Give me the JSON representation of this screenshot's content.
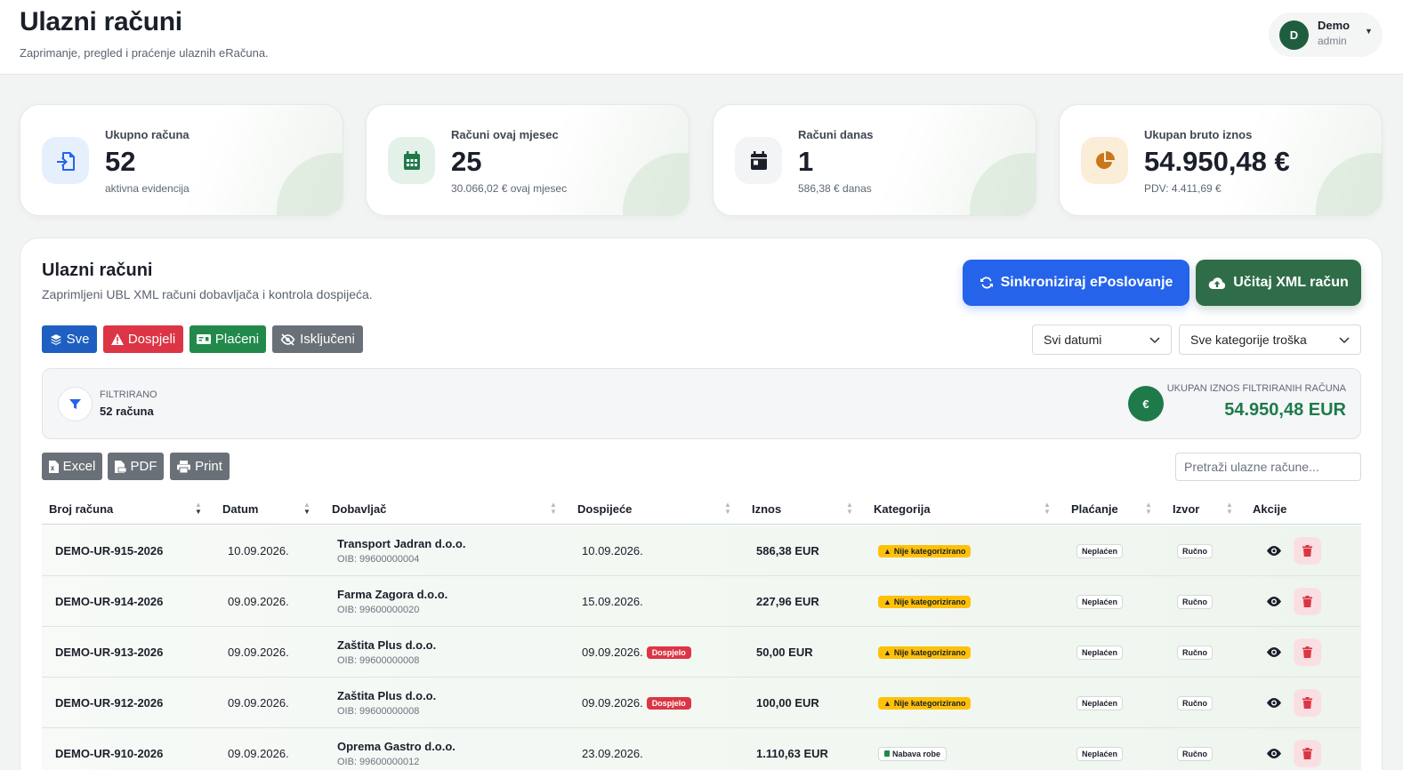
{
  "header": {
    "title": "Ulazni računi",
    "subtitle": "Zaprimanje, pregled i praćenje ulaznih eRačuna."
  },
  "user": {
    "initial": "D",
    "name": "Demo",
    "role": "admin"
  },
  "stats": [
    {
      "label": "Ukupno računa",
      "value": "52",
      "sub": "aktivna evidencija",
      "icon": "file-import-icon",
      "color": "#2563eb"
    },
    {
      "label": "Računi ovaj mjesec",
      "value": "25",
      "sub": "30.066,02 € ovaj mjesec",
      "icon": "calendar-days-icon",
      "color": "#1f7a4a"
    },
    {
      "label": "Računi danas",
      "value": "1",
      "sub": "586,38 € danas",
      "icon": "calendar-day-icon",
      "color": "#1b1f2a"
    },
    {
      "label": "Ukupan bruto iznos",
      "value": "54.950,48 €",
      "sub": "PDV: 4.411,69 €",
      "icon": "pie-chart-icon",
      "color": "#c9771c"
    }
  ],
  "panel": {
    "title": "Ulazni računi",
    "subtitle": "Zaprimljeni UBL XML računi dobavljača i kontrola dospijeća.",
    "sync_label": "Sinkroniziraj ePoslovanje",
    "upload_label": "Učitaj XML račun"
  },
  "filters": {
    "all": "Sve",
    "due": "Dospjeli",
    "paid": "Plaćeni",
    "excluded": "Isključeni"
  },
  "selects": {
    "date": "Svi datumi",
    "category": "Sve kategorije troška"
  },
  "summary": {
    "filtered_label": "FILTRIRANO",
    "filtered_count": "52 računa",
    "currency_symbol": "€",
    "total_label": "UKUPAN IZNOS FILTRIRANIH RAČUNA",
    "total_value": "54.950,48 EUR"
  },
  "exports": {
    "excel": "Excel",
    "pdf": "PDF",
    "print": "Print"
  },
  "search": {
    "placeholder": "Pretraži ulazne račune..."
  },
  "table": {
    "columns": [
      "Broj računa",
      "Datum",
      "Dobavljač",
      "Dospijeće",
      "Iznos",
      "Kategorija",
      "Plaćanje",
      "Izvor",
      "Akcije"
    ],
    "rows": [
      {
        "number": "DEMO-UR-915-2026",
        "date": "10.09.2026.",
        "supplier": "Transport Jadran d.o.o.",
        "oib": "OIB: 99600000004",
        "due": "10.09.2026.",
        "due_badge": "",
        "amount": "586,38 EUR",
        "category": "Nije kategorizirano",
        "category_type": "warn",
        "payment": "Neplaćen",
        "source": "Ručno"
      },
      {
        "number": "DEMO-UR-914-2026",
        "date": "09.09.2026.",
        "supplier": "Farma Zagora d.o.o.",
        "oib": "OIB: 99600000020",
        "due": "15.09.2026.",
        "due_badge": "",
        "amount": "227,96 EUR",
        "category": "Nije kategorizirano",
        "category_type": "warn",
        "payment": "Neplaćen",
        "source": "Ručno"
      },
      {
        "number": "DEMO-UR-913-2026",
        "date": "09.09.2026.",
        "supplier": "Zaštita Plus d.o.o.",
        "oib": "OIB: 99600000008",
        "due": "09.09.2026.",
        "due_badge": "Dospjelo",
        "amount": "50,00 EUR",
        "category": "Nije kategorizirano",
        "category_type": "warn",
        "payment": "Neplaćen",
        "source": "Ručno"
      },
      {
        "number": "DEMO-UR-912-2026",
        "date": "09.09.2026.",
        "supplier": "Zaštita Plus d.o.o.",
        "oib": "OIB: 99600000008",
        "due": "09.09.2026.",
        "due_badge": "Dospjelo",
        "amount": "100,00 EUR",
        "category": "Nije kategorizirano",
        "category_type": "warn",
        "payment": "Neplaćen",
        "source": "Ručno"
      },
      {
        "number": "DEMO-UR-910-2026",
        "date": "09.09.2026.",
        "supplier": "Oprema Gastro d.o.o.",
        "oib": "OIB: 99600000012",
        "due": "23.09.2026.",
        "due_badge": "",
        "amount": "1.110,63 EUR",
        "category": "Nabava robe",
        "category_type": "goods",
        "payment": "Neplaćen",
        "source": "Ručno"
      }
    ]
  },
  "colors": {
    "accent_blue": "#2563eb",
    "brand_green": "#2f6d48",
    "danger": "#dc3545",
    "warning": "#ffc107"
  }
}
